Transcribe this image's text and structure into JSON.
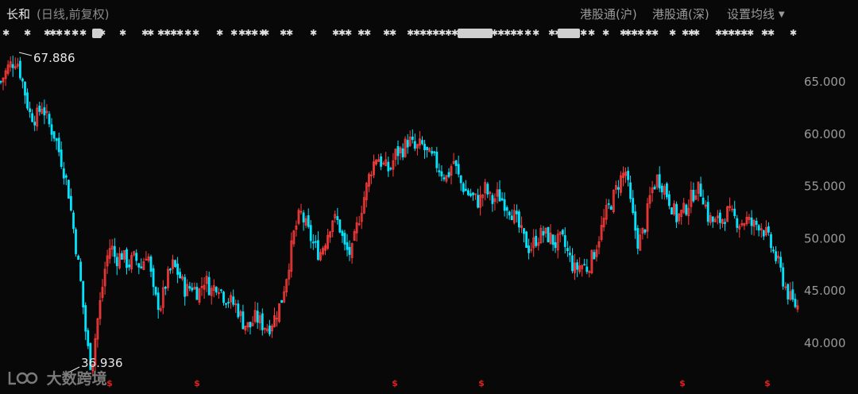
{
  "header": {
    "title": "长和",
    "subtitle": "(日线,前复权)",
    "btn_sh": "港股通(沪)",
    "btn_sz": "港股通(深)",
    "btn_ma": "设置均线"
  },
  "watermark": "大数跨境",
  "chart_data": {
    "type": "candlestick",
    "title": "长和",
    "subtitle": "(日线,前复权)",
    "ylim": [
      35,
      70
    ],
    "yticks": [
      40.0,
      45.0,
      50.0,
      55.0,
      60.0,
      65.0
    ],
    "ytick_labels": [
      "40.000",
      "45.000",
      "50.000",
      "55.000",
      "60.000",
      "65.000"
    ],
    "max_annotation": "67.886",
    "min_annotation": "36.936",
    "max_value": 67.886,
    "min_value": 36.936,
    "up_color": "#ff3b3b",
    "down_color": "#00e5ff",
    "close_path": [
      [
        0,
        65.0
      ],
      [
        5,
        66.5
      ],
      [
        10,
        67.2
      ],
      [
        14,
        64.8
      ],
      [
        18,
        62.0
      ],
      [
        22,
        61.5
      ],
      [
        26,
        62.8
      ],
      [
        30,
        61.0
      ],
      [
        34,
        59.8
      ],
      [
        38,
        57.5
      ],
      [
        42,
        55.0
      ],
      [
        46,
        50.5
      ],
      [
        50,
        46.0
      ],
      [
        54,
        40.0
      ],
      [
        57,
        37.5
      ],
      [
        60,
        41.5
      ],
      [
        63,
        44.5
      ],
      [
        66,
        47.8
      ],
      [
        69,
        49.5
      ],
      [
        72,
        48.0
      ],
      [
        76,
        48.5
      ],
      [
        80,
        47.5
      ],
      [
        84,
        48.2
      ],
      [
        88,
        47.2
      ],
      [
        92,
        49.0
      ],
      [
        96,
        44.5
      ],
      [
        100,
        43.5
      ],
      [
        104,
        46.0
      ],
      [
        108,
        47.5
      ],
      [
        112,
        46.5
      ],
      [
        116,
        45.0
      ],
      [
        120,
        45.5
      ],
      [
        124,
        44.8
      ],
      [
        128,
        46.2
      ],
      [
        132,
        45.0
      ],
      [
        136,
        45.8
      ],
      [
        140,
        44.5
      ],
      [
        144,
        44.0
      ],
      [
        148,
        43.5
      ],
      [
        152,
        42.0
      ],
      [
        156,
        41.5
      ],
      [
        160,
        42.5
      ],
      [
        164,
        41.8
      ],
      [
        168,
        41.5
      ],
      [
        172,
        42.5
      ],
      [
        176,
        44.0
      ],
      [
        180,
        47.0
      ],
      [
        184,
        50.5
      ],
      [
        188,
        52.5
      ],
      [
        192,
        51.0
      ],
      [
        196,
        49.5
      ],
      [
        200,
        48.5
      ],
      [
        204,
        50.0
      ],
      [
        208,
        52.0
      ],
      [
        212,
        51.5
      ],
      [
        216,
        49.0
      ],
      [
        220,
        48.5
      ],
      [
        224,
        51.5
      ],
      [
        228,
        54.0
      ],
      [
        232,
        56.5
      ],
      [
        236,
        58.0
      ],
      [
        240,
        57.0
      ],
      [
        244,
        56.5
      ],
      [
        248,
        58.2
      ],
      [
        252,
        58.5
      ],
      [
        256,
        59.5
      ],
      [
        260,
        58.5
      ],
      [
        264,
        59.0
      ],
      [
        268,
        58.0
      ],
      [
        272,
        57.5
      ],
      [
        276,
        56.5
      ],
      [
        280,
        55.8
      ],
      [
        284,
        57.5
      ],
      [
        288,
        55.5
      ],
      [
        292,
        54.5
      ],
      [
        296,
        54.0
      ],
      [
        300,
        53.5
      ],
      [
        304,
        54.8
      ],
      [
        308,
        53.5
      ],
      [
        312,
        54.2
      ],
      [
        316,
        53.5
      ],
      [
        320,
        52.8
      ],
      [
        324,
        51.5
      ],
      [
        328,
        50.0
      ],
      [
        332,
        49.0
      ],
      [
        336,
        50.0
      ],
      [
        340,
        50.5
      ],
      [
        344,
        50.2
      ],
      [
        348,
        49.5
      ],
      [
        352,
        50.0
      ],
      [
        356,
        48.5
      ],
      [
        360,
        47.0
      ],
      [
        364,
        47.5
      ],
      [
        368,
        47.2
      ],
      [
        372,
        48.5
      ],
      [
        376,
        50.5
      ],
      [
        380,
        52.5
      ],
      [
        384,
        53.8
      ],
      [
        388,
        55.5
      ],
      [
        392,
        56.5
      ],
      [
        396,
        52.5
      ],
      [
        400,
        49.5
      ],
      [
        404,
        51.0
      ],
      [
        408,
        54.5
      ],
      [
        412,
        55.8
      ],
      [
        416,
        55.0
      ],
      [
        420,
        53.5
      ],
      [
        424,
        52.0
      ],
      [
        428,
        52.5
      ],
      [
        432,
        53.5
      ],
      [
        436,
        54.8
      ],
      [
        440,
        54.5
      ],
      [
        444,
        52.0
      ],
      [
        448,
        51.5
      ],
      [
        452,
        51.8
      ],
      [
        456,
        52.5
      ],
      [
        460,
        52.0
      ],
      [
        464,
        51.5
      ],
      [
        468,
        51.8
      ],
      [
        472,
        51.2
      ],
      [
        476,
        51.5
      ],
      [
        480,
        50.5
      ],
      [
        484,
        49.0
      ],
      [
        488,
        47.5
      ],
      [
        492,
        45.5
      ],
      [
        496,
        44.0
      ],
      [
        500,
        43.5
      ]
    ],
    "close_path_domain": [
      0,
      500
    ]
  }
}
